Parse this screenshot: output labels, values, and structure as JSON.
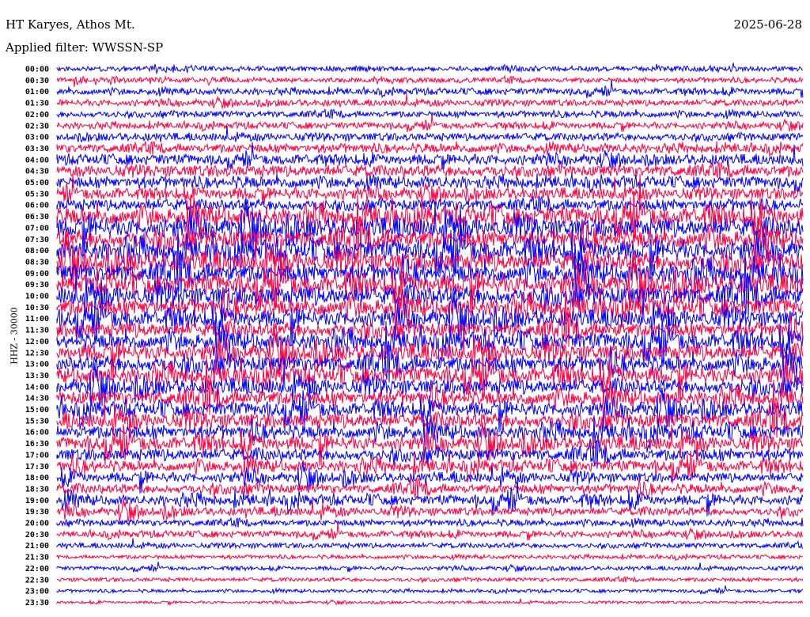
{
  "header": {
    "station": "HT Karyes, Athos Mt.",
    "filter": "Applied filter: WWSSN-SP",
    "date": "2025-06-28"
  },
  "chart_data": {
    "type": "line",
    "title": "HT Karyes, Athos Mt.",
    "ylabel": "HHZ - 30000",
    "colors": [
      "#0000ff",
      "#ff0040"
    ],
    "time_labels": [
      "00:00",
      "00:30",
      "01:00",
      "01:30",
      "02:00",
      "02:30",
      "03:00",
      "03:30",
      "04:00",
      "04:30",
      "05:00",
      "05:30",
      "06:00",
      "06:30",
      "07:00",
      "07:30",
      "08:00",
      "08:30",
      "09:00",
      "09:30",
      "10:00",
      "10:30",
      "11:00",
      "11:30",
      "12:00",
      "12:30",
      "13:00",
      "13:30",
      "14:00",
      "14:30",
      "15:00",
      "15:30",
      "16:00",
      "16:30",
      "17:00",
      "17:30",
      "18:00",
      "18:30",
      "19:00",
      "19:30",
      "20:00",
      "20:30",
      "21:00",
      "21:30",
      "22:00",
      "22:30",
      "23:00",
      "23:30"
    ],
    "relative_amplitude": [
      0.4,
      0.4,
      0.5,
      0.5,
      0.5,
      0.5,
      0.6,
      0.7,
      0.8,
      0.9,
      0.9,
      0.9,
      0.9,
      1.3,
      1.4,
      1.4,
      1.4,
      1.4,
      1.4,
      1.4,
      1.4,
      1.3,
      1.2,
      1.1,
      1.2,
      1.2,
      1.2,
      1.2,
      1.1,
      1.1,
      1.0,
      1.1,
      1.0,
      1.0,
      0.9,
      0.8,
      0.7,
      0.7,
      0.7,
      0.6,
      0.5,
      0.5,
      0.4,
      0.3,
      0.3,
      0.3,
      0.25,
      0.2
    ]
  }
}
